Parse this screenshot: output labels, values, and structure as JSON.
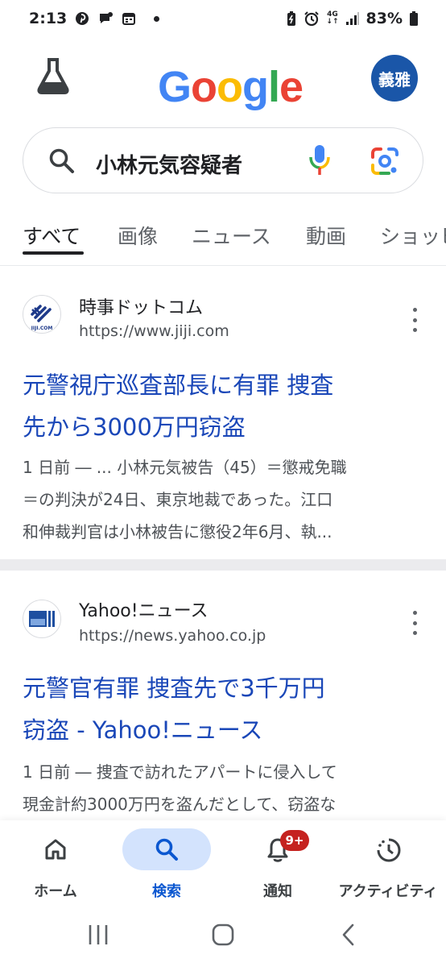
{
  "status_bar": {
    "time": "2:13",
    "network": "4G",
    "battery": "83%"
  },
  "header": {
    "logo": "Google",
    "logo_colors": [
      "#4285F4",
      "#EA4335",
      "#FBBC05",
      "#4285F4",
      "#34A853",
      "#EA4335"
    ],
    "avatar_text": "義雅"
  },
  "search": {
    "query": "小林元気容疑者"
  },
  "tabs": [
    {
      "label": "すべて",
      "active": true
    },
    {
      "label": "画像",
      "active": false
    },
    {
      "label": "ニュース",
      "active": false
    },
    {
      "label": "動画",
      "active": false
    },
    {
      "label": "ショッピング",
      "active": false
    }
  ],
  "results": [
    {
      "site_name": "時事ドットコム",
      "favicon_text": "JIJI.COM",
      "url": "https://www.jiji.com",
      "title_lines": [
        "元警視庁巡査部長に有罪 捜査",
        "先から3000万円窃盗"
      ],
      "snippet_lines": [
        "1 日前 ― ... 小林元気被告（45）＝懲戒免職",
        "＝の判決が24日、東京地裁であった。江口",
        "和伸裁判官は小林被告に懲役2年6月、執..."
      ]
    },
    {
      "site_name": "Yahoo!ニュース",
      "url": "https://news.yahoo.co.jp",
      "title_lines": [
        "元警官有罪 捜査先で3千万円",
        "窃盗 - Yahoo!ニュース"
      ],
      "snippet_lines": [
        "1 日前 ― 捜査で訪れたアパートに侵入して",
        "現金計約3000万円を盗んだとして、窃盗な"
      ]
    }
  ],
  "bottom_nav": [
    {
      "label": "ホーム",
      "icon": "home-icon",
      "active": false
    },
    {
      "label": "検索",
      "icon": "search-icon",
      "active": true
    },
    {
      "label": "通知",
      "icon": "bell-icon",
      "active": false,
      "badge": "9+"
    },
    {
      "label": "アクティビティ",
      "icon": "activity-icon",
      "active": false
    }
  ],
  "colors": {
    "link": "#1a47b8",
    "active_nav": "#0b57d0",
    "active_pill": "#d3e3fd",
    "badge": "#c5221f",
    "avatar": "#1a56a8"
  }
}
